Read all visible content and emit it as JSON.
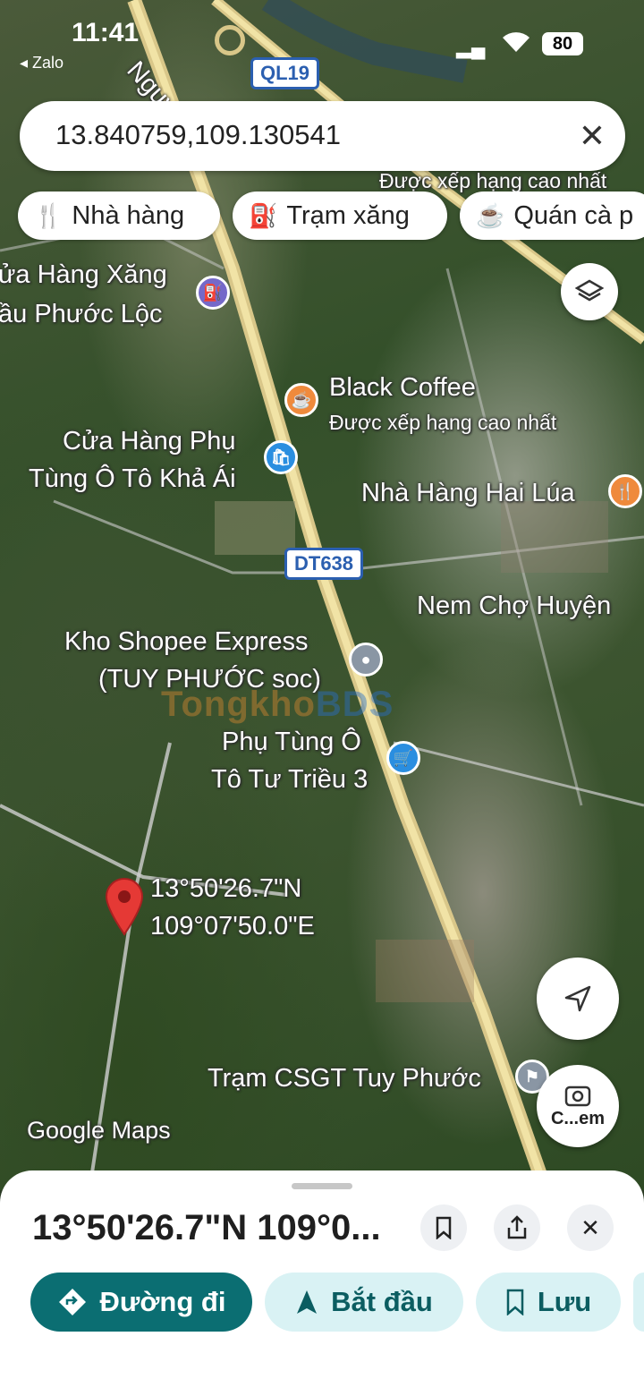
{
  "status_bar": {
    "time": "11:41",
    "back_app": "Zalo",
    "battery": "80"
  },
  "search": {
    "query": "13.840759,109.130541"
  },
  "chips": [
    {
      "label": "Nhà hàng",
      "icon": "fork-knife-icon"
    },
    {
      "label": "Trạm xăng",
      "icon": "gas-pump-icon"
    },
    {
      "label": "Quán cà p",
      "icon": "coffee-cup-icon"
    }
  ],
  "map": {
    "road_top": "Nguyễn",
    "shield_ql19": "QL19",
    "shield_dt638": "DT638",
    "top_right_note": "Được xếp hạng cao nhất",
    "places": {
      "gas_station_line1": "ửa Hàng Xăng",
      "gas_station_line2": "ầu Phước Lộc",
      "black_coffee": "Black Coffee",
      "black_coffee_note": "Được xếp hạng cao nhất",
      "auto_parts_line1": "Cửa Hàng Phụ",
      "auto_parts_line2": "Tùng Ô Tô Khả Ái",
      "hai_lua": "Nhà Hàng Hai Lúa",
      "nem_cho": "Nem Chợ Huyện",
      "shopee_line1": "Kho Shopee Express",
      "shopee_line2": "(TUY PHƯỚC soc)",
      "tu_trieu_line1": "Phụ Tùng Ô",
      "tu_trieu_line2": "Tô Tư Triều 3",
      "csgt": "Trạm CSGT Tuy Phước"
    },
    "pin_lat": "13°50'26.7\"N",
    "pin_lng": "109°07'50.0\"E",
    "attribution": "Google Maps",
    "watermark_a": "Tongkho",
    "watermark_b": "BDS",
    "lens_label": "C...em"
  },
  "sheet": {
    "title": "13°50'26.7\"N 109°0...",
    "directions": "Đường đi",
    "start": "Bắt đầu",
    "save": "Lưu"
  },
  "colors": {
    "primary": "#0b6e72",
    "secondary_bg": "#d9f2f4",
    "pin_red": "#e53935"
  }
}
